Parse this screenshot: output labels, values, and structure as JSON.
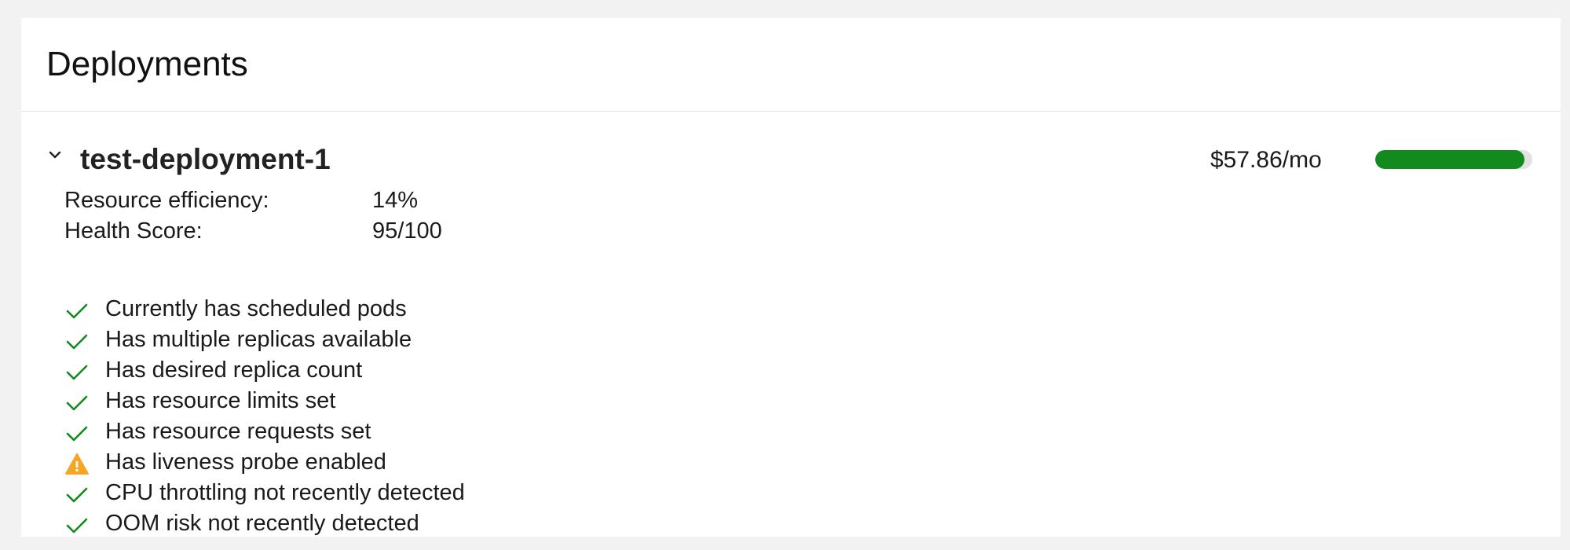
{
  "page": {
    "title": "Deployments"
  },
  "deployment": {
    "name": "test-deployment-1",
    "cost": "$57.86/mo",
    "cost_bar_fraction": 0.95,
    "colors": {
      "bar": "#138a1e",
      "ok": "#138a1e",
      "warning": "#f5a623"
    },
    "metrics": [
      {
        "label": "Resource efficiency:",
        "value": "14%"
      },
      {
        "label": "Health Score:",
        "value": "95/100"
      }
    ],
    "checks": [
      {
        "label": "Currently has scheduled pods",
        "status": "ok",
        "icon": "check-icon"
      },
      {
        "label": "Has multiple replicas available",
        "status": "ok",
        "icon": "check-icon"
      },
      {
        "label": "Has desired replica count",
        "status": "ok",
        "icon": "check-icon"
      },
      {
        "label": "Has resource limits set",
        "status": "ok",
        "icon": "check-icon"
      },
      {
        "label": "Has resource requests set",
        "status": "ok",
        "icon": "check-icon"
      },
      {
        "label": "Has liveness probe enabled",
        "status": "warning",
        "icon": "warning-icon"
      },
      {
        "label": "CPU throttling not recently detected",
        "status": "ok",
        "icon": "check-icon"
      },
      {
        "label": "OOM risk not recently detected",
        "status": "ok",
        "icon": "check-icon"
      }
    ]
  }
}
